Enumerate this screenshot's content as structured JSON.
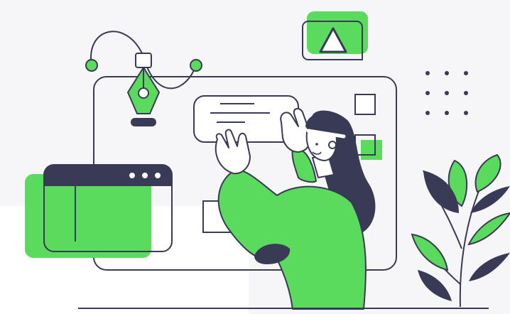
{
  "illustration": {
    "colors": {
      "accent_green": "#5BDB5E",
      "ink_navy": "#393A55",
      "panel_gray": "#F5F5F7",
      "paper_white": "#FFFFFF"
    },
    "icons": [
      "pen-tool-icon",
      "warning-triangle-icon",
      "dot-grid-icon",
      "browser-window-icon",
      "plant-icon",
      "person-icon"
    ]
  }
}
